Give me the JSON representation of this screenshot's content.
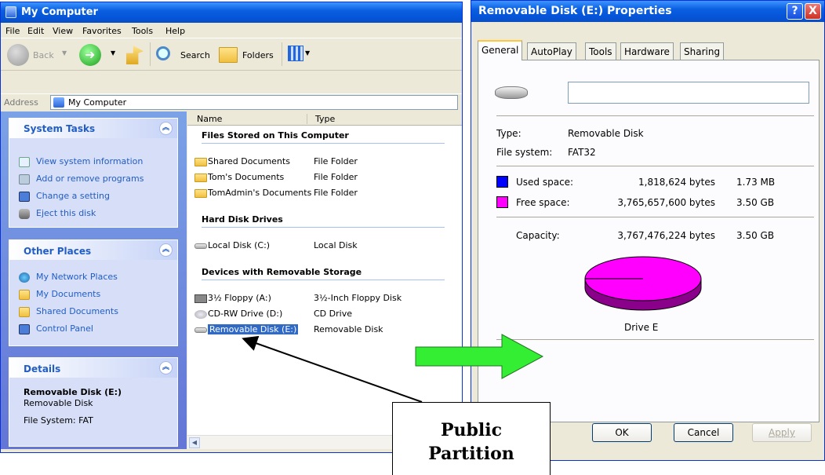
{
  "my_computer": {
    "title": "My Computer",
    "menu": [
      "File",
      "Edit",
      "View",
      "Favorites",
      "Tools",
      "Help"
    ],
    "toolbar": {
      "back": "Back",
      "search": "Search",
      "folders": "Folders"
    },
    "address_label": "Address",
    "address_value": "My Computer",
    "system_tasks": {
      "title": "System Tasks",
      "items": [
        "View system information",
        "Add or remove programs",
        "Change a setting",
        "Eject this disk"
      ]
    },
    "other_places": {
      "title": "Other Places",
      "items": [
        "My Network Places",
        "My Documents",
        "Shared Documents",
        "Control Panel"
      ]
    },
    "details": {
      "title": "Details",
      "name": "Removable Disk (E:)",
      "type": "Removable Disk",
      "fs": "File System: FAT"
    },
    "columns": {
      "name": "Name",
      "type": "Type"
    },
    "groups": {
      "files": "Files Stored on This Computer",
      "hard": "Hard Disk Drives",
      "removable": "Devices with Removable Storage"
    },
    "files": [
      {
        "name": "Shared Documents",
        "type": "File Folder"
      },
      {
        "name": "Tom's Documents",
        "type": "File Folder"
      },
      {
        "name": "TomAdmin's Documents",
        "type": "File Folder"
      }
    ],
    "hard_drives": [
      {
        "name": "Local Disk (C:)",
        "type": "Local Disk"
      }
    ],
    "removable": [
      {
        "name": "3½ Floppy (A:)",
        "type": "3½-Inch Floppy Disk"
      },
      {
        "name": "CD-RW Drive (D:)",
        "type": "CD Drive"
      },
      {
        "name": "Removable Disk (E:)",
        "type": "Removable Disk"
      }
    ]
  },
  "properties": {
    "title": "Removable Disk (E:) Properties",
    "help_btn": "?",
    "close_btn": "X",
    "tabs": [
      "General",
      "AutoPlay",
      "Tools",
      "Hardware",
      "Sharing"
    ],
    "label_value": "",
    "type_label": "Type:",
    "type_value": "Removable Disk",
    "fs_label": "File system:",
    "fs_value": "FAT32",
    "used_label": "Used space:",
    "used_bytes": "1,818,624 bytes",
    "used_short": "1.73 MB",
    "free_label": "Free space:",
    "free_bytes": "3,765,657,600 bytes",
    "free_short": "3.50 GB",
    "cap_label": "Capacity:",
    "cap_bytes": "3,767,476,224 bytes",
    "cap_short": "3.50 GB",
    "drive_label": "Drive E",
    "used_color": "#0000ff",
    "free_color": "#ff00ff",
    "ok": "OK",
    "cancel": "Cancel",
    "apply": "Apply"
  },
  "callout": {
    "line1": "Public",
    "line2": "Partition"
  }
}
